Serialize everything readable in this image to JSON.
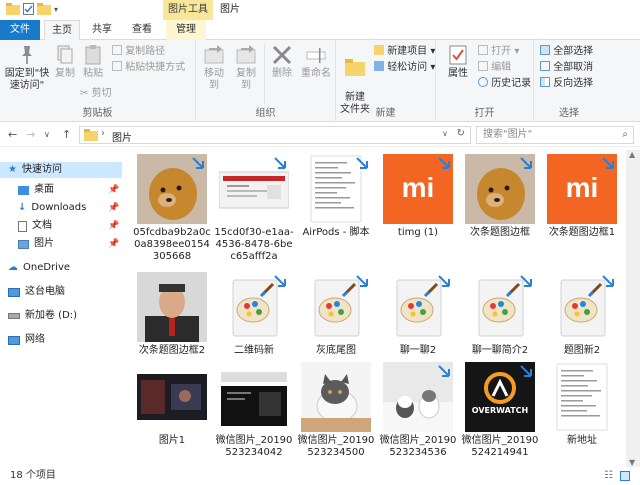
{
  "title_bar": {
    "context_tab": "图片工具",
    "window_title": "图片"
  },
  "tabs": {
    "file": "文件",
    "home": "主页",
    "share": "共享",
    "view": "查看",
    "manage": "管理"
  },
  "ribbon": {
    "clipboard": {
      "pin": "固定到\"快速访问\"",
      "copy": "复制",
      "paste": "粘贴",
      "copy_path": "复制路径",
      "paste_shortcut": "粘贴快捷方式",
      "cut": "剪切",
      "label": "剪贴板"
    },
    "organize": {
      "move_to": "移动到",
      "copy_to": "复制到",
      "delete": "删除",
      "rename": "重命名",
      "label": "组织"
    },
    "new": {
      "new_folder": "新建\n文件夹",
      "new_item": "新建项目",
      "easy_access": "轻松访问",
      "label": "新建"
    },
    "open": {
      "properties": "属性",
      "open": "打开",
      "edit": "编辑",
      "history": "历史记录",
      "label": "打开"
    },
    "select": {
      "select_all": "全部选择",
      "select_none": "全部取消",
      "invert": "反向选择",
      "label": "选择"
    }
  },
  "address": {
    "path": "图片",
    "search_placeholder": "搜索\"图片\""
  },
  "sidebar": {
    "items": [
      {
        "label": "快速访问"
      },
      {
        "label": "桌面"
      },
      {
        "label": "Downloads"
      },
      {
        "label": "文档"
      },
      {
        "label": "图片"
      },
      {
        "label": "OneDrive"
      },
      {
        "label": "这台电脑"
      },
      {
        "label": "新加卷 (D:)"
      },
      {
        "label": "网络"
      }
    ]
  },
  "files": [
    {
      "name": "05fcdba9b2a0c0a8398ee0154305668",
      "kind": "dog"
    },
    {
      "name": "15cd0f30-e1aa-4536-8478-6bec65afff2a",
      "kind": "screen"
    },
    {
      "name": "AirPods - 脚本",
      "kind": "doc"
    },
    {
      "name": "timg (1)",
      "kind": "mi"
    },
    {
      "name": "次条题图边框",
      "kind": "dog"
    },
    {
      "name": "次条题图边框1",
      "kind": "mi"
    },
    {
      "name": "次条题图边框2",
      "kind": "person"
    },
    {
      "name": "二维码新",
      "kind": "paint"
    },
    {
      "name": "灰底尾图",
      "kind": "paint"
    },
    {
      "name": "聊一聊2",
      "kind": "paint"
    },
    {
      "name": "聊一聊简介2",
      "kind": "paint"
    },
    {
      "name": "题图新2",
      "kind": "paint"
    },
    {
      "name": "图片1",
      "kind": "dark"
    },
    {
      "name": "微信图片_20190523234042",
      "kind": "screen2"
    },
    {
      "name": "微信图片_20190523234500",
      "kind": "cat"
    },
    {
      "name": "微信图片_20190523234536",
      "kind": "cats"
    },
    {
      "name": "微信图片_20190524214941",
      "kind": "overwatch"
    },
    {
      "name": "新地址",
      "kind": "doc"
    }
  ],
  "overwatch_text": "OVERWATCH",
  "mi_logo": "mi",
  "status": {
    "count": "18 个项目"
  },
  "colors": {
    "file_tab": "#1979ca",
    "context_tab": "#f8e79b",
    "mi_orange": "#f26522",
    "selected": "#cce8ff"
  }
}
